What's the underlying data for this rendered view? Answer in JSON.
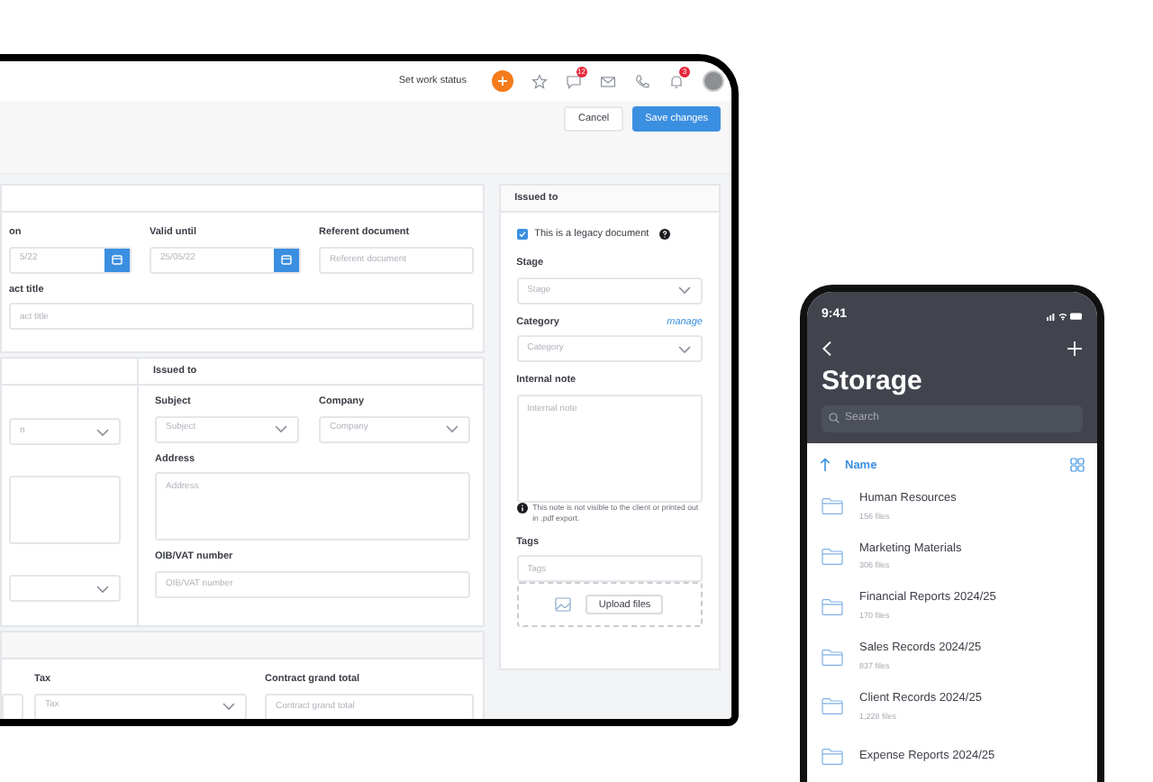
{
  "header": {
    "status_link": "Set work status",
    "chat_badge": "12",
    "bell_badge": "3"
  },
  "actions": {
    "cancel": "Cancel",
    "save": "Save changes"
  },
  "dates_card": {
    "fields": [
      {
        "label": "on",
        "placeholder": "5/22",
        "kind": "date"
      },
      {
        "label": "Valid until",
        "placeholder": "25/05/22",
        "kind": "date"
      },
      {
        "label": "Referent document",
        "placeholder": "Referent document",
        "kind": "text"
      }
    ],
    "title_field": {
      "label": "act title",
      "placeholder": "act title"
    }
  },
  "parties_card": {
    "left": [
      {
        "kind": "select",
        "placeholder": "n"
      },
      {
        "kind": "textarea"
      },
      {
        "kind": "select"
      }
    ],
    "issued_to": {
      "title": "Issued to",
      "fields": [
        {
          "label": "Subject",
          "placeholder": "Subject",
          "kind": "select"
        },
        {
          "label": "Company",
          "placeholder": "Company",
          "kind": "select"
        },
        {
          "label": "Address",
          "placeholder": "Address",
          "kind": "textarea"
        },
        {
          "label": "OIB/VAT number",
          "placeholder": "OIB/VAT number",
          "kind": "text"
        }
      ]
    }
  },
  "totals_card": {
    "fields": [
      {
        "kind": "text"
      },
      {
        "label": "Tax",
        "placeholder": "Tax",
        "kind": "select"
      },
      {
        "label": "Contract grand total",
        "placeholder": "Contract grand total",
        "kind": "text"
      }
    ]
  },
  "side_panel": {
    "title": "Issued to",
    "legacy": {
      "label": "This is a legacy document",
      "checked": true
    },
    "stage": {
      "label": "Stage",
      "placeholder": "Stage"
    },
    "category": {
      "label": "Category",
      "placeholder": "Category",
      "link": "manage"
    },
    "internal_note": {
      "label": "Internal note",
      "placeholder": "Internal note",
      "hint": "This note is not visible to the client or printed out in .pdf export."
    },
    "tags": {
      "label": "Tags",
      "placeholder": "Tags"
    },
    "upload": "Upload files"
  },
  "phone": {
    "time": "9:41",
    "title": "Storage",
    "search_placeholder": "Search",
    "sort": "Name",
    "folders": [
      {
        "name": "Human Resources",
        "count": "156 files"
      },
      {
        "name": "Marketing Materials",
        "count": "306 files"
      },
      {
        "name": "Financial Reports 2024/25",
        "count": "170 files"
      },
      {
        "name": "Sales Records 2024/25",
        "count": "837 files"
      },
      {
        "name": "Client Records 2024/25",
        "count": "1,228 files"
      },
      {
        "name": "Expense Reports 2024/25"
      }
    ]
  }
}
